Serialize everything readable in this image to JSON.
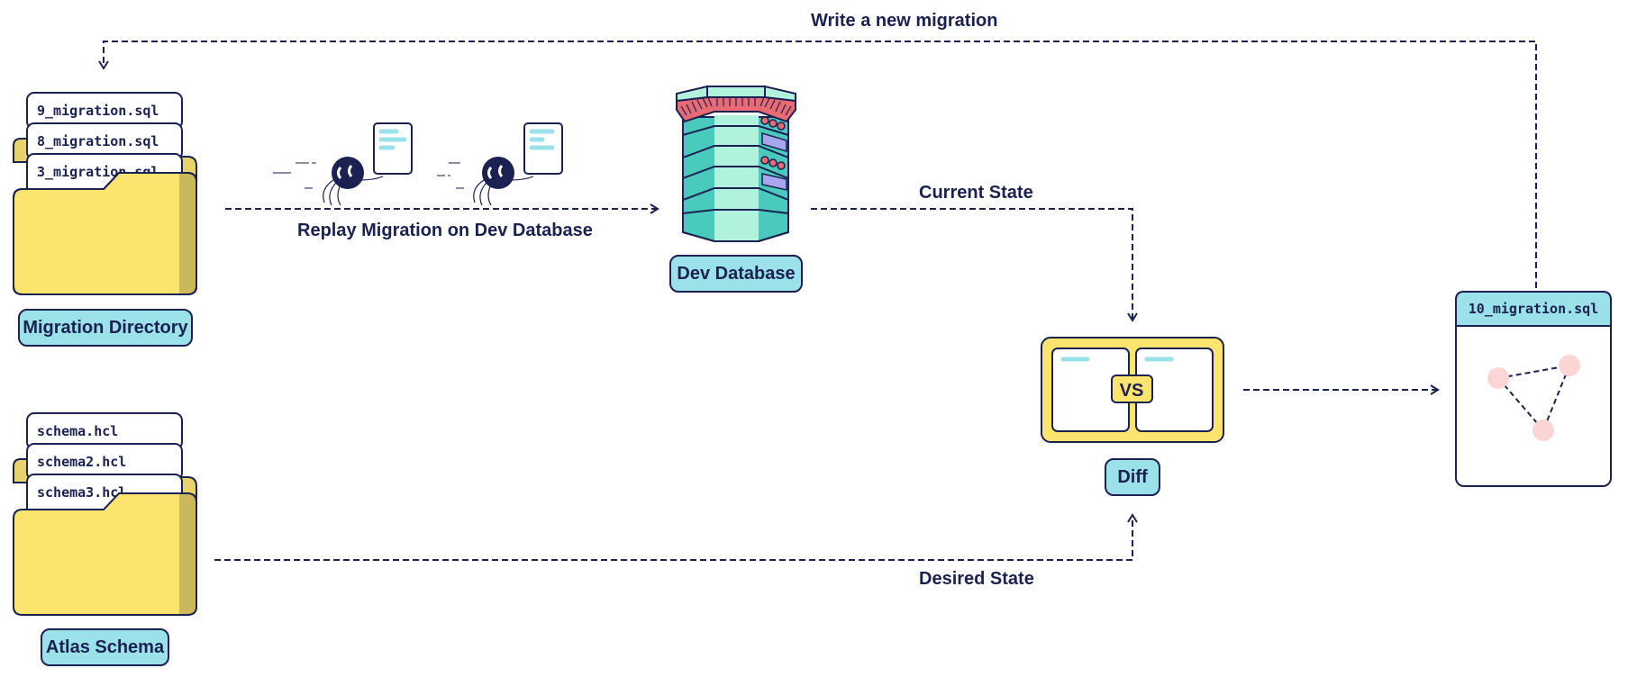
{
  "colors": {
    "navy": "#1b2150",
    "folder_yellow": "#fde46f",
    "folder_back": "#e8d26a",
    "folder_shadow": "#cbb85a",
    "label_cyan": "#9ae1ea",
    "db_mint": "#b0f2dc",
    "db_teal": "#4ac9bd",
    "db_coral": "#e86a72",
    "db_purple": "#a9a6f0",
    "node_pink": "#fdd5d5"
  },
  "migration_directory": {
    "label": "Migration Directory",
    "files": [
      "9_migration.sql",
      "8_migration.sql",
      "3_migration.sql"
    ]
  },
  "atlas_schema": {
    "label": "Atlas Schema",
    "files": [
      "schema.hcl",
      "schema2.hcl",
      "schema3.hcl"
    ]
  },
  "dev_database": {
    "label": "Dev Database"
  },
  "diff": {
    "label": "Diff",
    "vs_text": "VS"
  },
  "new_migration": {
    "filename": "10_migration.sql"
  },
  "edges": {
    "replay": "Replay Migration on Dev Database",
    "current_state": "Current State",
    "desired_state": "Desired State",
    "write_new": "Write a new migration"
  }
}
